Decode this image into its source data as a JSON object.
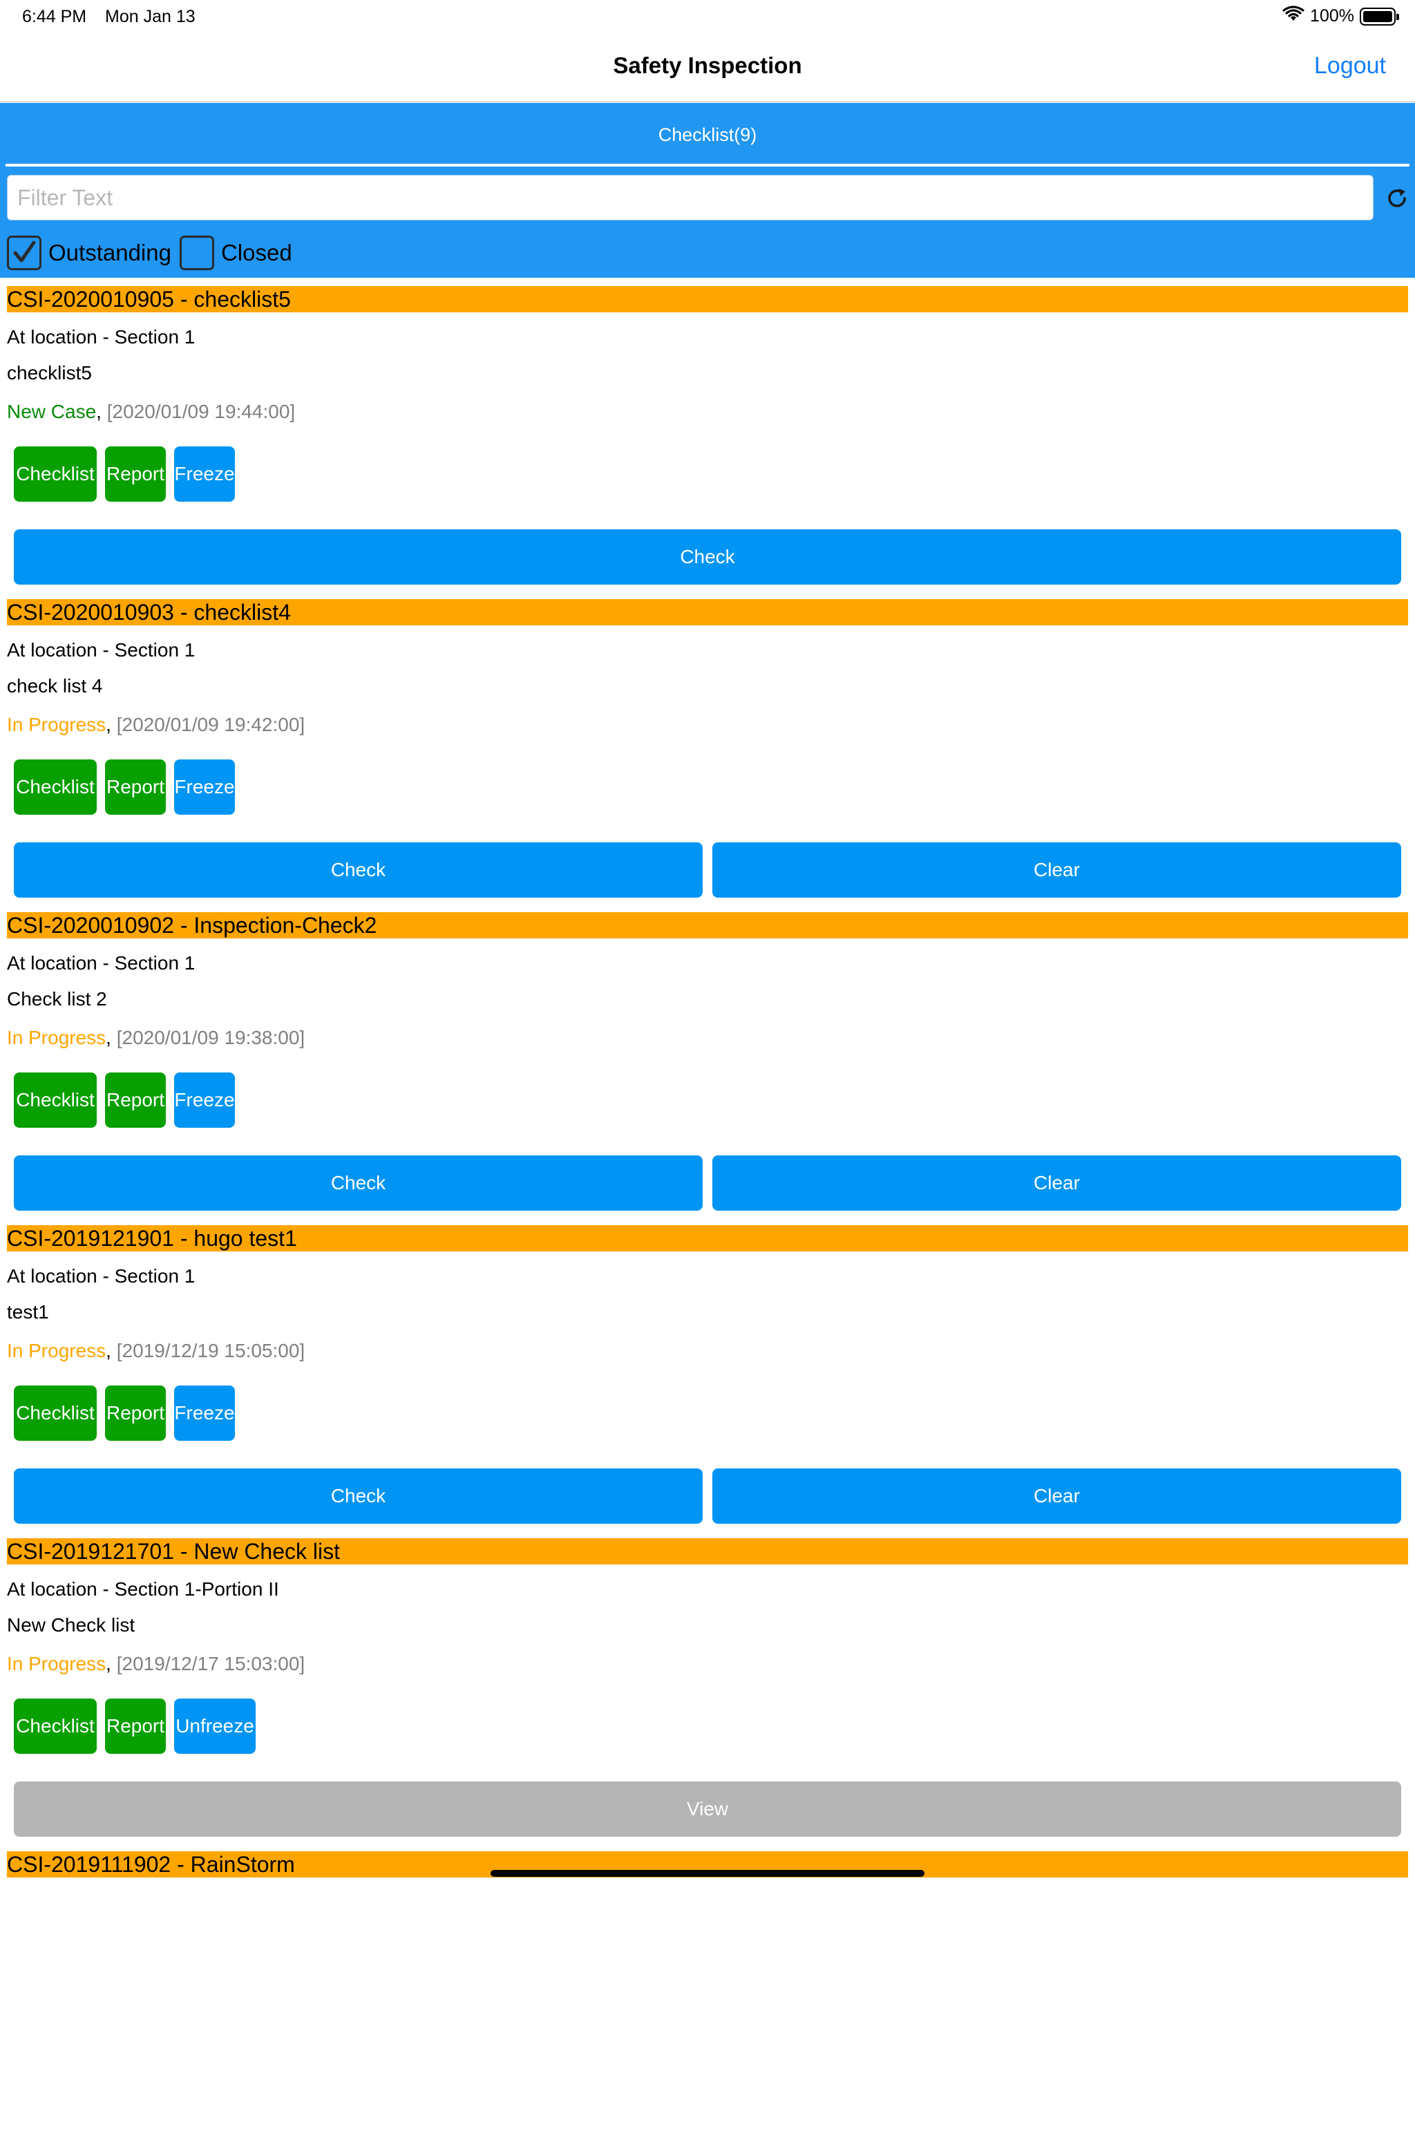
{
  "status_bar": {
    "time": "6:44 PM",
    "date": "Mon Jan 13",
    "battery": "100%"
  },
  "nav": {
    "title": "Safety Inspection",
    "logout": "Logout"
  },
  "tab": {
    "label": "Checklist(9)"
  },
  "filter": {
    "placeholder": "Filter Text",
    "value": ""
  },
  "filters": {
    "outstanding": {
      "label": "Outstanding",
      "checked": true
    },
    "closed": {
      "label": "Closed",
      "checked": false
    }
  },
  "cards": [
    {
      "title": "CSI-2020010905 - checklist5",
      "location": "At location - Section 1",
      "description": "checklist5",
      "status": "New Case",
      "timestamp": "[2020/01/09 19:44:00]",
      "buttons": [
        "Checklist",
        "Report",
        "Freeze"
      ],
      "actions": [
        "Check"
      ]
    },
    {
      "title": "CSI-2020010903 - checklist4",
      "location": "At location - Section 1",
      "description": "check list 4",
      "status": "In Progress",
      "timestamp": "[2020/01/09 19:42:00]",
      "buttons": [
        "Checklist",
        "Report",
        "Freeze"
      ],
      "actions": [
        "Check",
        "Clear"
      ]
    },
    {
      "title": "CSI-2020010902 - Inspection-Check2",
      "location": "At location - Section 1",
      "description": "Check list 2",
      "status": "In Progress",
      "timestamp": "[2020/01/09 19:38:00]",
      "buttons": [
        "Checklist",
        "Report",
        "Freeze"
      ],
      "actions": [
        "Check",
        "Clear"
      ]
    },
    {
      "title": "CSI-2019121901 - hugo test1",
      "location": "At location - Section 1",
      "description": "test1",
      "status": "In Progress",
      "timestamp": "[2019/12/19 15:05:00]",
      "buttons": [
        "Checklist",
        "Report",
        "Freeze"
      ],
      "actions": [
        "Check",
        "Clear"
      ]
    },
    {
      "title": "CSI-2019121701 - New Check list",
      "location": "At location - Section 1-Portion II",
      "description": "New Check list",
      "status": "In Progress",
      "timestamp": "[2019/12/17 15:03:00]",
      "buttons": [
        "Checklist",
        "Report",
        "Unfreeze"
      ],
      "actions": [
        "View"
      ]
    }
  ],
  "partial_card": {
    "title": "CSI-2019111902 - RainStorm"
  },
  "colors": {
    "header_blue": "#2196f3",
    "title_orange": "#ffa500",
    "button_green": "#08a000",
    "button_blue": "#0095f4",
    "button_gray": "#b5b5b5",
    "status_new": "#0a8a0a",
    "status_in_progress": "#ffa500",
    "link_blue": "#147efb"
  }
}
